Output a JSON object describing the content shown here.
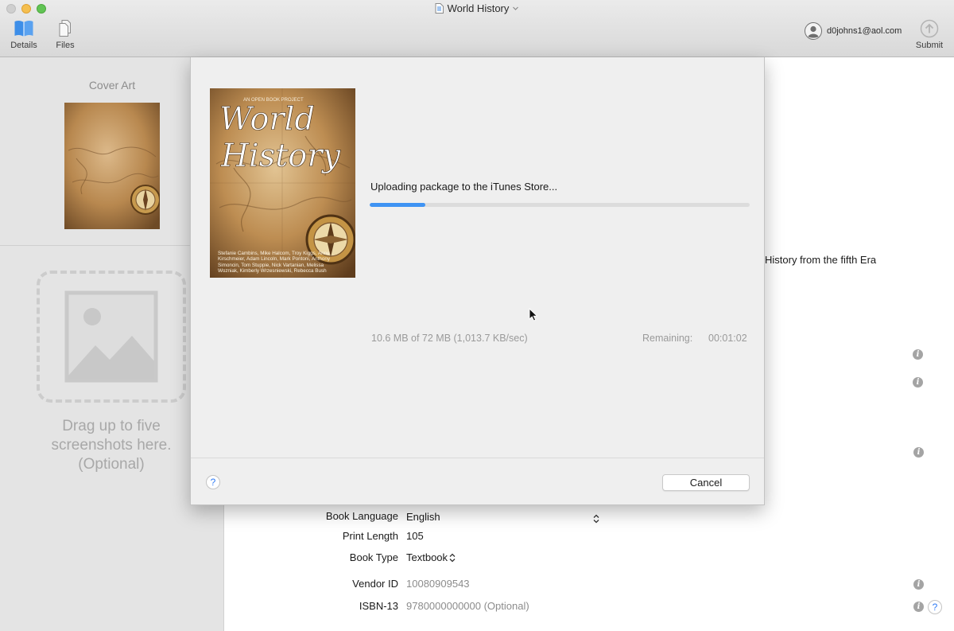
{
  "window": {
    "title": "World History"
  },
  "toolbar": {
    "details_label": "Details",
    "files_label": "Files",
    "account_email": "d0johns1@aol.com",
    "submit_label": "Submit"
  },
  "sidebar": {
    "cover_art_label": "Cover Art",
    "drop_text": [
      "Drag up to five",
      "screenshots here.",
      "(Optional)"
    ]
  },
  "cover": {
    "series_label": "AN OPEN BOOK PROJECT",
    "title_lines": [
      "World",
      "History"
    ],
    "authors": "Stefanie Cambins, Mike Halcom, Troy Kiggs, Anne Kirschmeier, Adam Lincoln, Mark Pontoni, Anthony Simoncin, Tom Stuppie, Nick Vartanian, Melissa Wozniak, Kimberly Wrzesniewski, Rebecca Bush"
  },
  "main": {
    "description_fragment": "History from the fifth Era",
    "fields": [
      {
        "label": "Book Language",
        "value": "English"
      },
      {
        "label": "Print Length",
        "value": "105"
      },
      {
        "label": "Book Type",
        "value": "Textbook"
      },
      {
        "label": "Vendor ID",
        "value": "10080909543"
      },
      {
        "label": "ISBN-13",
        "value": "9780000000000 (Optional)"
      }
    ]
  },
  "upload": {
    "status": "Uploading package to the iTunes Store...",
    "progress_fraction": 0.147,
    "transfer_stats": "10.6 MB of 72 MB (1,013.7 KB/sec)",
    "remaining_label": "Remaining:",
    "remaining_time": "00:01:02",
    "cancel_label": "Cancel",
    "help_label": "?"
  },
  "icons": {
    "info": "i",
    "help": "?"
  },
  "colors": {
    "accent": "#3f93f3",
    "toolbar_icon": "#3d8ee8"
  }
}
